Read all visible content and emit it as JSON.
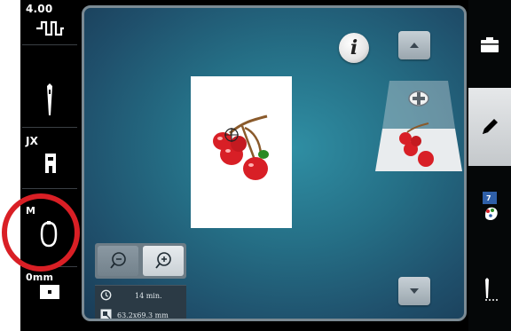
{
  "status": {
    "stitch_width": "4.00",
    "foot_label": "JX",
    "hoop_label": "M",
    "thread_tension": "0mm"
  },
  "info": {
    "button_label": "i",
    "stitch_time": "14 min.",
    "design_size": "63.2x69.3 mm"
  },
  "icons": {
    "info": "info-icon",
    "scroll_up": "arrow-up-icon",
    "scroll_down": "arrow-down-icon",
    "add_design": "plus-icon",
    "zoom_out": "zoom-out-icon",
    "zoom_in": "zoom-in-icon",
    "clock": "clock-icon",
    "size": "size-icon",
    "folder": "folder-icon",
    "edit": "pencil-icon",
    "color": "color-palette-icon",
    "stitch": "stitch-icon"
  },
  "toolbar": {
    "color_count": "7"
  },
  "colors": {
    "accent_ring": "#d91f25",
    "background_top": "#2f8ea3",
    "background_bottom": "#1a3c57",
    "cherry_red": "#d81f26",
    "stem_brown": "#8a5a2b"
  }
}
